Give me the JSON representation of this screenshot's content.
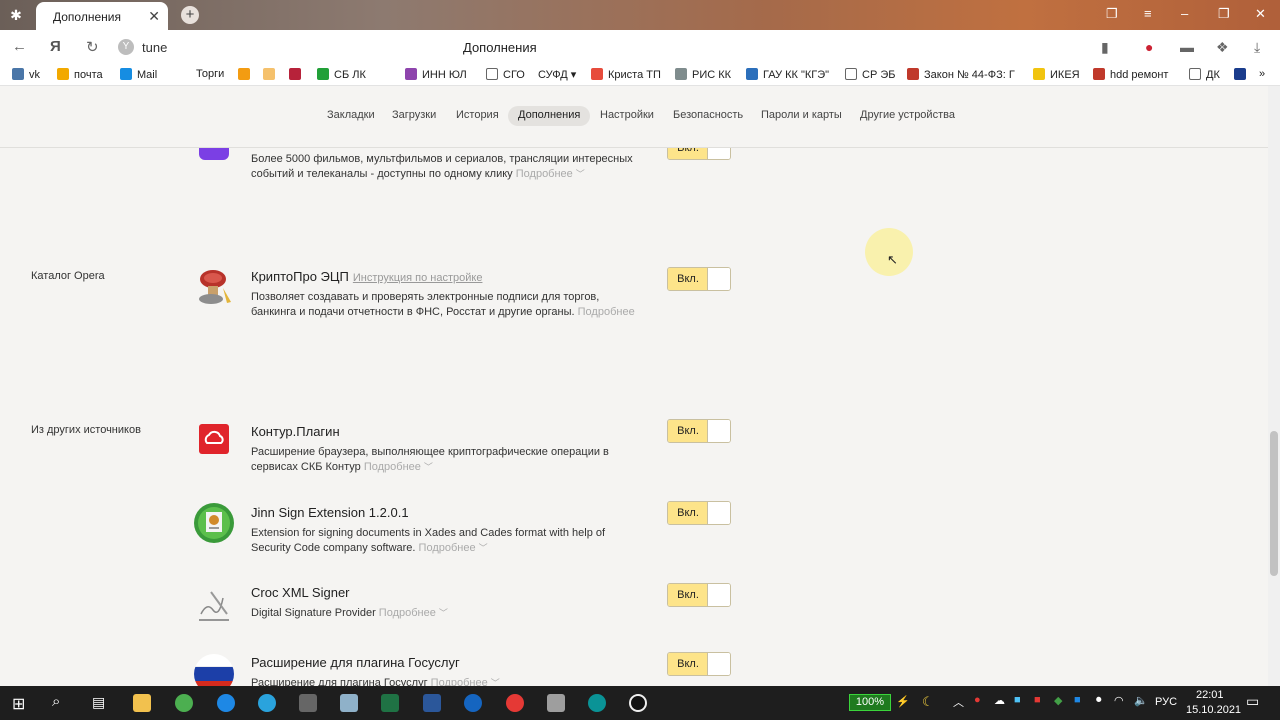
{
  "browser": {
    "tab_title": "Дополнения",
    "omnibox_text": "tune",
    "page_title": "Дополнения"
  },
  "bookmarks": [
    "vk",
    "почта",
    "Mail",
    "Торги",
    "СБ ЛК",
    "ИНН ЮЛ",
    "СГО",
    "СУФД",
    "Криста ТП",
    "РИС КК",
    "ГАУ КК \"КГЭ\"",
    "СР ЭБ",
    "Закон № 44-ФЗ: Г",
    "ИКЕЯ",
    "hdd ремонт",
    "ДК"
  ],
  "settings_nav": [
    "Закладки",
    "Загрузки",
    "История",
    "Дополнения",
    "Настройки",
    "Безопасность",
    "Пароли и карты",
    "Другие устройства"
  ],
  "sections": {
    "opera": "Каталог Opera",
    "other": "Из других источников"
  },
  "toggle_label": "Вкл.",
  "more_label": "Подробнее",
  "extensions": [
    {
      "name": "",
      "desc": "Более 5000 фильмов, мультфильмов и сериалов, трансляции интересных событий и телеканалы - доступны по одному клику"
    },
    {
      "name": "КриптоПро ЭЦП",
      "link": "Инструкция по настройке",
      "desc": "Позволяет создавать и проверять электронные подписи для торгов, банкинга и подачи отчетности в ФНС, Росстат и другие органы."
    },
    {
      "name": "Контур.Плагин",
      "desc": "Расширение браузера, выполняющее криптографические операции в сервисах СКБ Контур"
    },
    {
      "name": "Jinn Sign Extension 1.2.0.1",
      "desc": "Extension for signing documents in Xades and Cades format with help of Security Code company software."
    },
    {
      "name": "Croc XML Signer",
      "desc": "Digital Signature Provider"
    },
    {
      "name": "Расширение для плагина Госуслуг",
      "desc": "Расширение для плагина Госуслуг"
    }
  ],
  "taskbar": {
    "battery": "100%",
    "lang": "РУС",
    "time": "22:01",
    "date": "15.10.2021"
  },
  "colors": {
    "toggle_on": "#fde48a",
    "accent_red": "#e0242b"
  }
}
